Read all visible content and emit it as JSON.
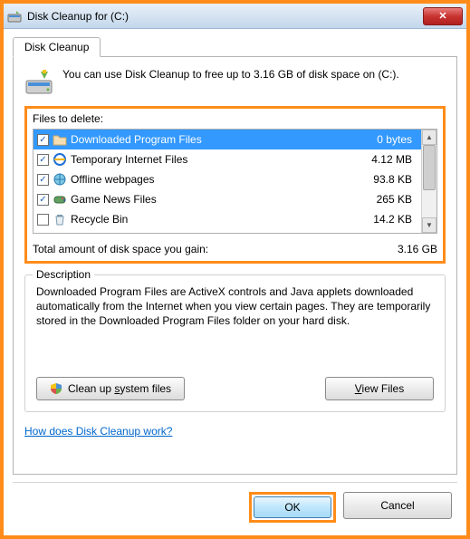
{
  "window": {
    "title": "Disk Cleanup for  (C:)"
  },
  "tab": {
    "label": "Disk Cleanup"
  },
  "intro": {
    "text": "You can use Disk Cleanup to free up to 3.16 GB of disk space on (C:)."
  },
  "files_section": {
    "label": "Files to delete:",
    "items": [
      {
        "checked": true,
        "name": "Downloaded Program Files",
        "size": "0 bytes",
        "selected": true,
        "icon": "folder"
      },
      {
        "checked": true,
        "name": "Temporary Internet Files",
        "size": "4.12 MB",
        "selected": false,
        "icon": "ie"
      },
      {
        "checked": true,
        "name": "Offline webpages",
        "size": "93.8 KB",
        "selected": false,
        "icon": "web"
      },
      {
        "checked": true,
        "name": "Game News Files",
        "size": "265 KB",
        "selected": false,
        "icon": "game"
      },
      {
        "checked": false,
        "name": "Recycle Bin",
        "size": "14.2 KB",
        "selected": false,
        "icon": "recycle"
      }
    ],
    "total_label": "Total amount of disk space you gain:",
    "total_value": "3.16 GB"
  },
  "description": {
    "group_title": "Description",
    "text": "Downloaded Program Files are ActiveX controls and Java applets downloaded automatically from the Internet when you view certain pages. They are temporarily stored in the Downloaded Program Files folder on your hard disk.",
    "cleanup_btn": "Clean up system files",
    "cleanup_accel": "s",
    "view_btn": "View Files",
    "view_accel": "V"
  },
  "link": {
    "text": "How does Disk Cleanup work?"
  },
  "buttons": {
    "ok": "OK",
    "cancel": "Cancel"
  }
}
